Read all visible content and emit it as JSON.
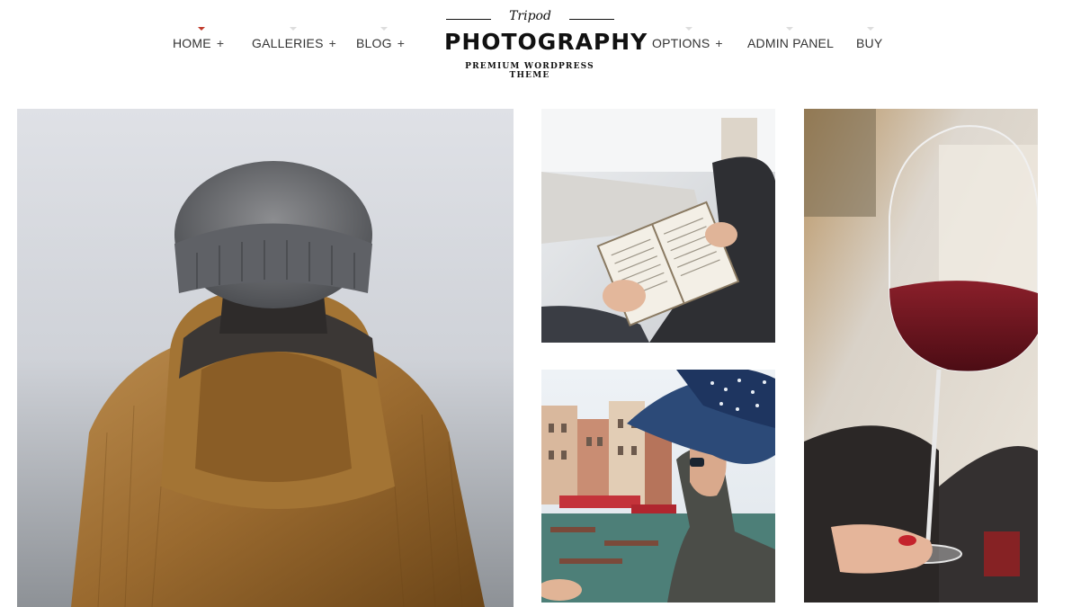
{
  "nav": {
    "left": [
      {
        "label": "HOME",
        "plus": "+"
      },
      {
        "label": "GALLERIES",
        "plus": "+"
      },
      {
        "label": "BLOG",
        "plus": "+"
      }
    ],
    "right": [
      {
        "label": "OPTIONS",
        "plus": "+"
      },
      {
        "label": "ADMIN PANEL"
      },
      {
        "label": "BUY"
      }
    ]
  },
  "logo": {
    "script": "Tripod",
    "main": "PHOTOGRAPHY",
    "sub": "PREMIUM WORDPRESS THEME"
  },
  "colors": {
    "accent": "#c0392b",
    "text": "#333333",
    "background": "#ffffff"
  },
  "gallery": [
    {
      "subject": "person in knit beanie and brown hooded corduroy jacket"
    },
    {
      "subject": "hands holding an open book"
    },
    {
      "subject": "woman in polka-dot blue hat by a canal"
    },
    {
      "subject": "hand holding a glass of red wine"
    }
  ]
}
